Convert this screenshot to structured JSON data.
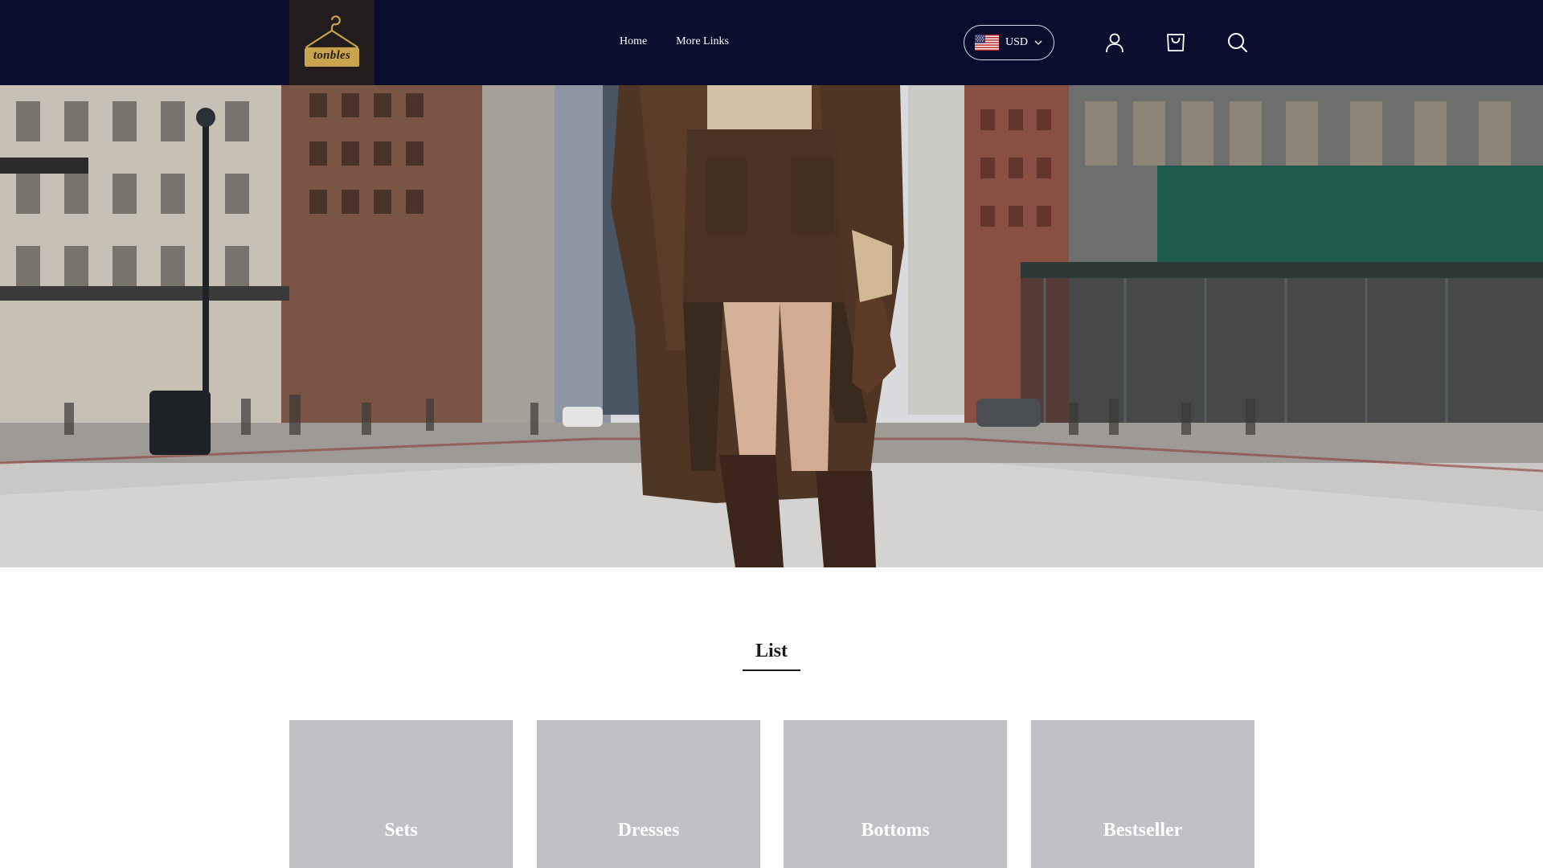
{
  "header": {
    "brand": "tonbles",
    "nav": [
      {
        "label": "Home"
      },
      {
        "label": "More Links"
      }
    ],
    "currency": {
      "code": "USD",
      "flag": "us-flag-icon"
    },
    "icons": [
      "user-icon",
      "cart-icon",
      "search-icon"
    ],
    "colors": {
      "background": "#0a0d2d",
      "logo_bg": "#231c1c",
      "logo_gold": "#c9a34d"
    }
  },
  "hero": {
    "image": "woman in brown coat and boots on city street"
  },
  "list": {
    "title": "List",
    "categories": [
      {
        "label": "Sets"
      },
      {
        "label": "Dresses"
      },
      {
        "label": "Bottoms"
      },
      {
        "label": "Bestseller"
      }
    ]
  }
}
